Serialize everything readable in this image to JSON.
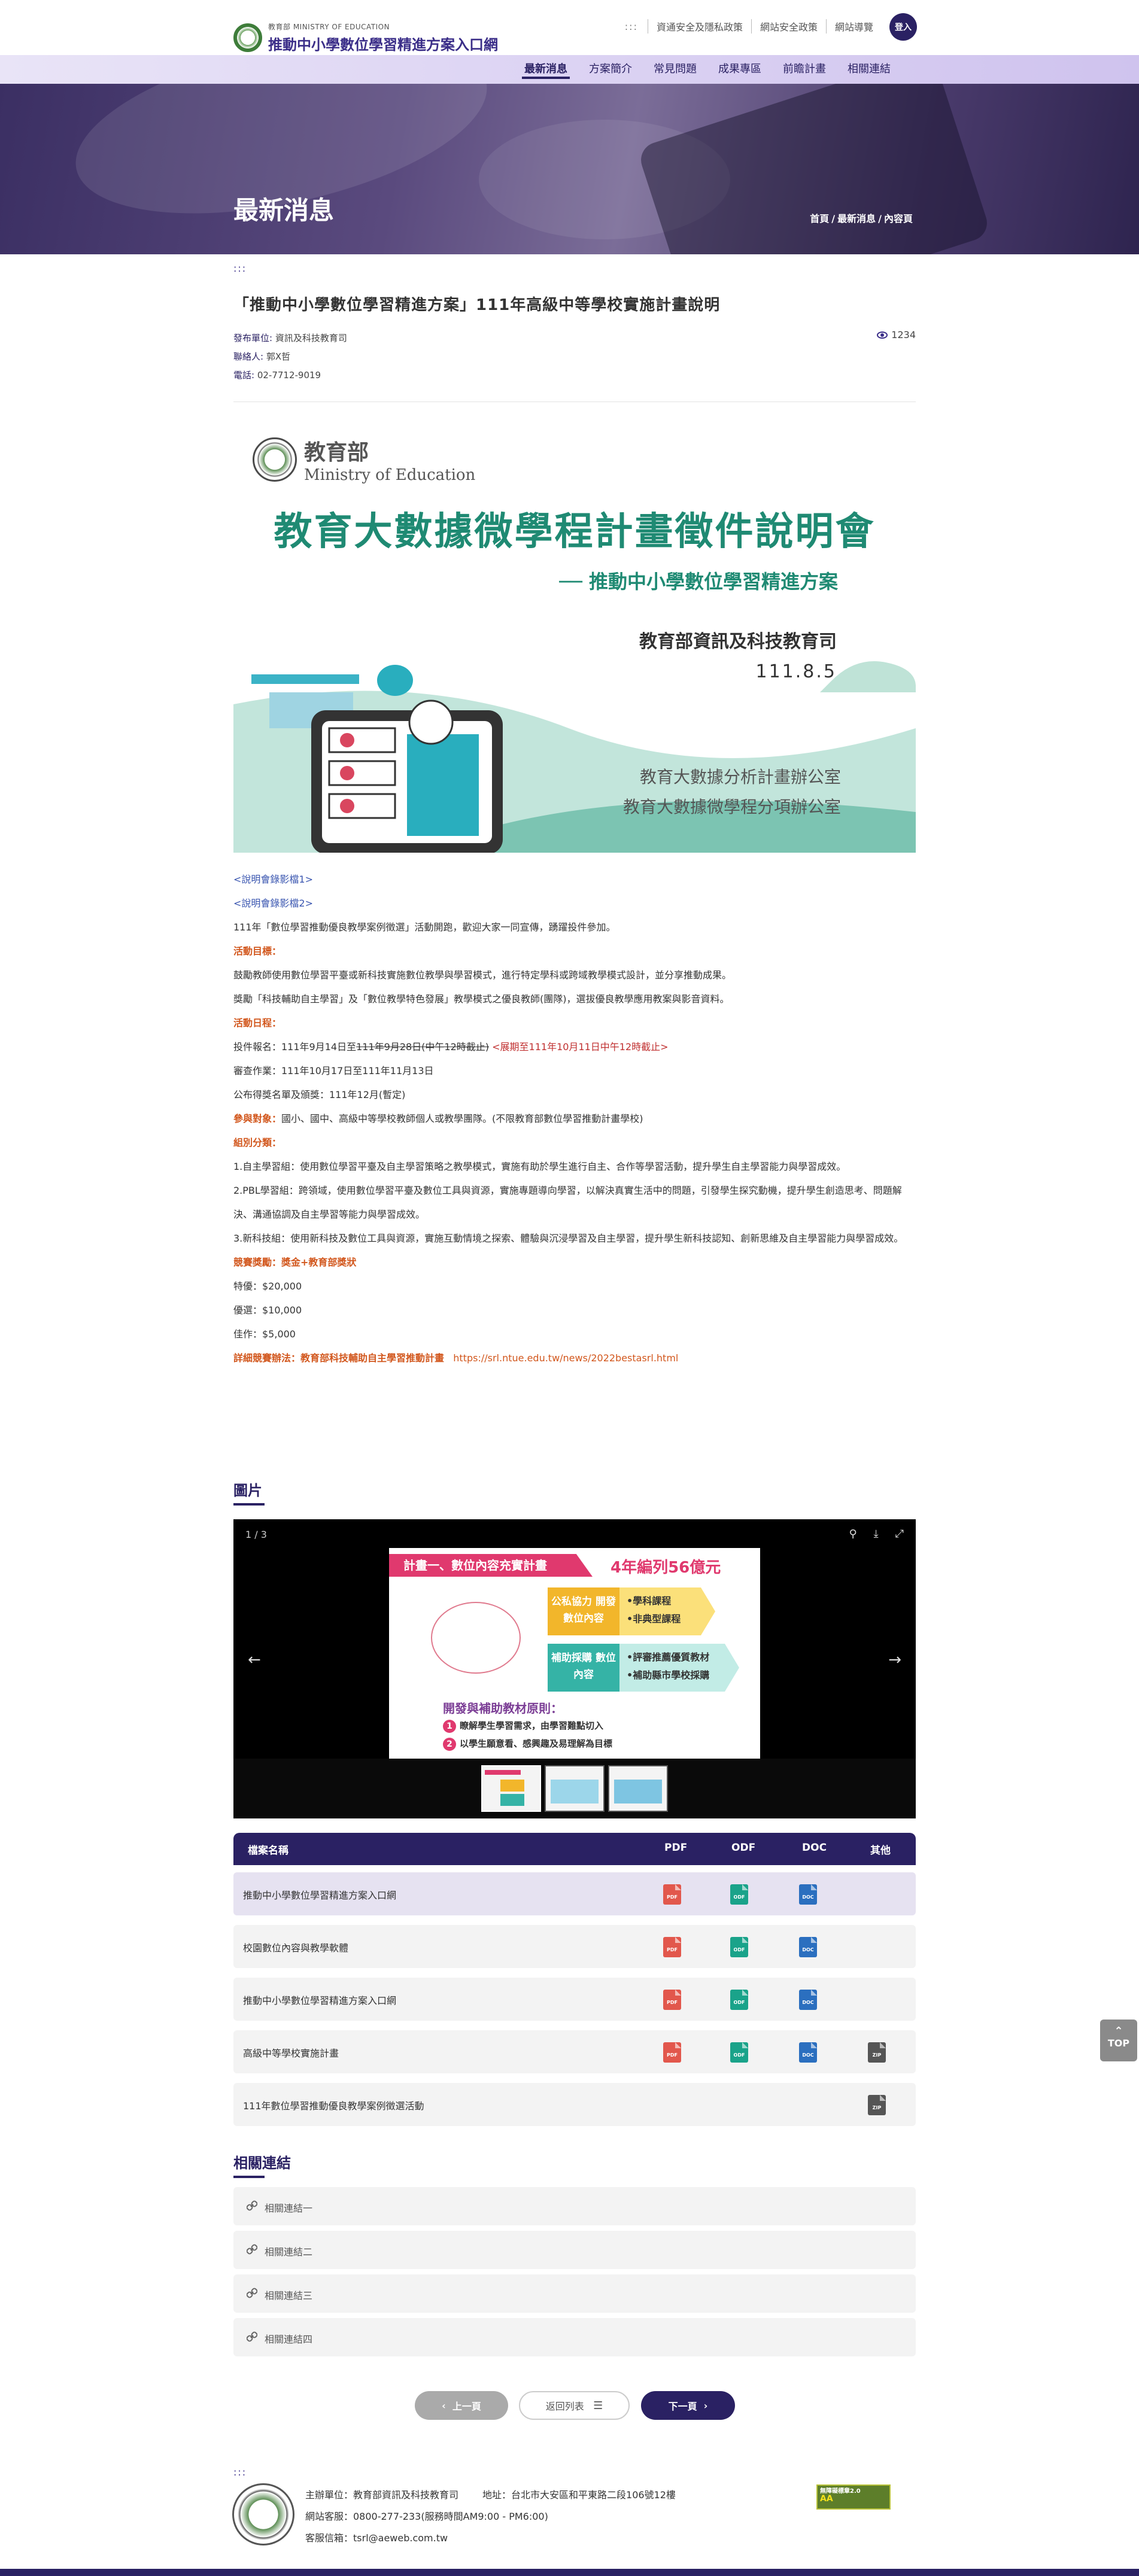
{
  "header": {
    "logo_small": "教育部 MINISTRY OF EDUCATION",
    "logo_title": "推動中小學數位學習精進方案入口網",
    "top_links": [
      "資通安全及隱私政策",
      "網站安全政策",
      "網站導覽"
    ],
    "login_label": "登入",
    "nav": [
      "最新消息",
      "方案簡介",
      "常見問題",
      "成果專區",
      "前瞻計畫",
      "相關連結"
    ]
  },
  "banner": {
    "title": "最新消息",
    "breadcrumb": [
      "首頁",
      "最新消息",
      "內容頁"
    ]
  },
  "article": {
    "anchor": ":::",
    "title": "「推動中小學數位學習精進方案」111年高級中等學校實施計畫說明",
    "meta": [
      {
        "k": "發布單位:",
        "v": " 資訊及科技教育司"
      },
      {
        "k": "聯絡人:",
        "v": " 郭X哲"
      },
      {
        "k": "電話:",
        "v": " 02-7712-9019"
      }
    ],
    "views": "1234"
  },
  "poster": {
    "moe_t1": "教育部",
    "moe_t2": "Ministry of Education",
    "title": "教育大數據微學程計畫徵件說明會",
    "subtitle": "── 推動中小學數位學習精進方案",
    "dept": "教育部資訊及科技教育司",
    "date": "111.8.5",
    "office1": "教育大數據分析計畫辦公室",
    "office2": "教育大數據微學程分項辦公室"
  },
  "body": {
    "video1": "<說明會錄影檔1>",
    "video2": "<說明會錄影檔2>",
    "intro": "111年「數位學習推動優良教學案例徵選」活動開跑，歡迎大家一同宣傳，踴躍投件參加。",
    "goal_h": "活動目標：",
    "goal1": "鼓勵教師使用數位學習平臺或新科技實施數位教學與學習模式，進行特定學科或跨域教學模式設計，並分享推動成果。",
    "goal2": "獎勵「科技輔助自主學習」及「數位教學特色發展」教學模式之優良教師(團隊)，選拔優良教學應用教案與影音資料。",
    "sched_h": "活動日程：",
    "sched1_a": "投件報名：111年9月14日至",
    "sched1_strike": "111年9月28日(中午12時截止)",
    "sched1_red": "<展期至111年10月11日中午12時截止>",
    "sched2": "審查作業：111年10月17日至111年11月13日",
    "sched3": "公布得獎名單及頒獎：111年12月(暫定)",
    "target_h": "參與對象：",
    "target": "國小、國中、高級中等學校教師個人或教學團隊。(不限教育部數位學習推動計畫學校)",
    "group_h": "組別分類：",
    "group1": "1.自主學習組：使用數位學習平臺及自主學習策略之教學模式，實施有助於學生進行自主、合作等學習活動，提升學生自主學習能力與學習成效。",
    "group2": "2.PBL學習組：跨領域，使用數位學習平臺及數位工具與資源，實施專題導向學習，以解決真實生活中的問題，引發學生探究動機，提升學生創造思考、問題解決、溝通協調及自主學習等能力與學習成效。",
    "group3": "3.新科技組：使用新科技及數位工具與資源，實施互動情境之探索、體驗與沉浸學習及自主學習，提升學生新科技認知、創新思維及自主學習能力與學習成效。",
    "award_h": "競賽獎勵：獎金+教育部獎狀",
    "award1": "特優：$20,000",
    "award2": "優選：$10,000",
    "award3": "佳作：$5,000",
    "detail_h": "詳細競賽辦法：教育部科技輔助自主學習推動計畫",
    "detail_url": "https://srl.ntue.edu.tw/news/2022bestasrl.html"
  },
  "gallery": {
    "section_title": "圖片",
    "counter": "1 / 3",
    "slide_bar": "計畫一、數位內容充實計畫",
    "slide_amount": "4年編列56億元",
    "box1": "公私協力 開發數位內容",
    "box1_items": "•學科課程\n•非典型課程",
    "box2": "補助採購 數位內容",
    "box2_items": "•評審推薦優質教材\n•補助縣市學校採購",
    "principle": "開發與補助教材原則：",
    "pt1": "瞭解學生學習需求，由學習難點切入",
    "pt2": "以學生願意看、感興趣及易理解為目標"
  },
  "files": {
    "headers": {
      "name": "檔案名稱",
      "pdf": "PDF",
      "odf": "ODF",
      "doc": "DOC",
      "other": "其他"
    },
    "rows": [
      {
        "name": "推動中小學數位學習精進方案入口網",
        "pdf": true,
        "odf": true,
        "doc": true,
        "other": false
      },
      {
        "name": "校園數位內容與教學軟體",
        "pdf": true,
        "odf": true,
        "doc": true,
        "other": false
      },
      {
        "name": "推動中小學數位學習精進方案入口網",
        "pdf": true,
        "odf": true,
        "doc": true,
        "other": false
      },
      {
        "name": "高級中等學校實施計畫",
        "pdf": true,
        "odf": true,
        "doc": true,
        "other": true
      },
      {
        "name": "111年數位學習推動優良教學案例徵選活動",
        "pdf": false,
        "odf": false,
        "doc": false,
        "other": true
      }
    ]
  },
  "related": {
    "section_title": "相關連結",
    "items": [
      "相關連結一",
      "相關連結二",
      "相關連結三",
      "相關連結四"
    ]
  },
  "pager": {
    "prev": "上一頁",
    "list": "返回列表",
    "next": "下一頁"
  },
  "top_label": "TOP",
  "footer": {
    "anchor": ":::",
    "org": "主辦單位：教育部資訊及科技教育司",
    "addr": "地址：台北市大安區和平東路二段106號12樓",
    "service": "網站客服：0800-277-233(服務時間AM9:00 - PM6:00)",
    "email": "客服信箱：tsrl@aeweb.com.tw",
    "a11y_top": "無障礙標章2.0",
    "a11y_big": "AA"
  },
  "colors": {
    "primary": "#2a2163",
    "accent_orange": "#d2571d",
    "link": "#3a56b0",
    "poster_green": "#1f8a73"
  }
}
